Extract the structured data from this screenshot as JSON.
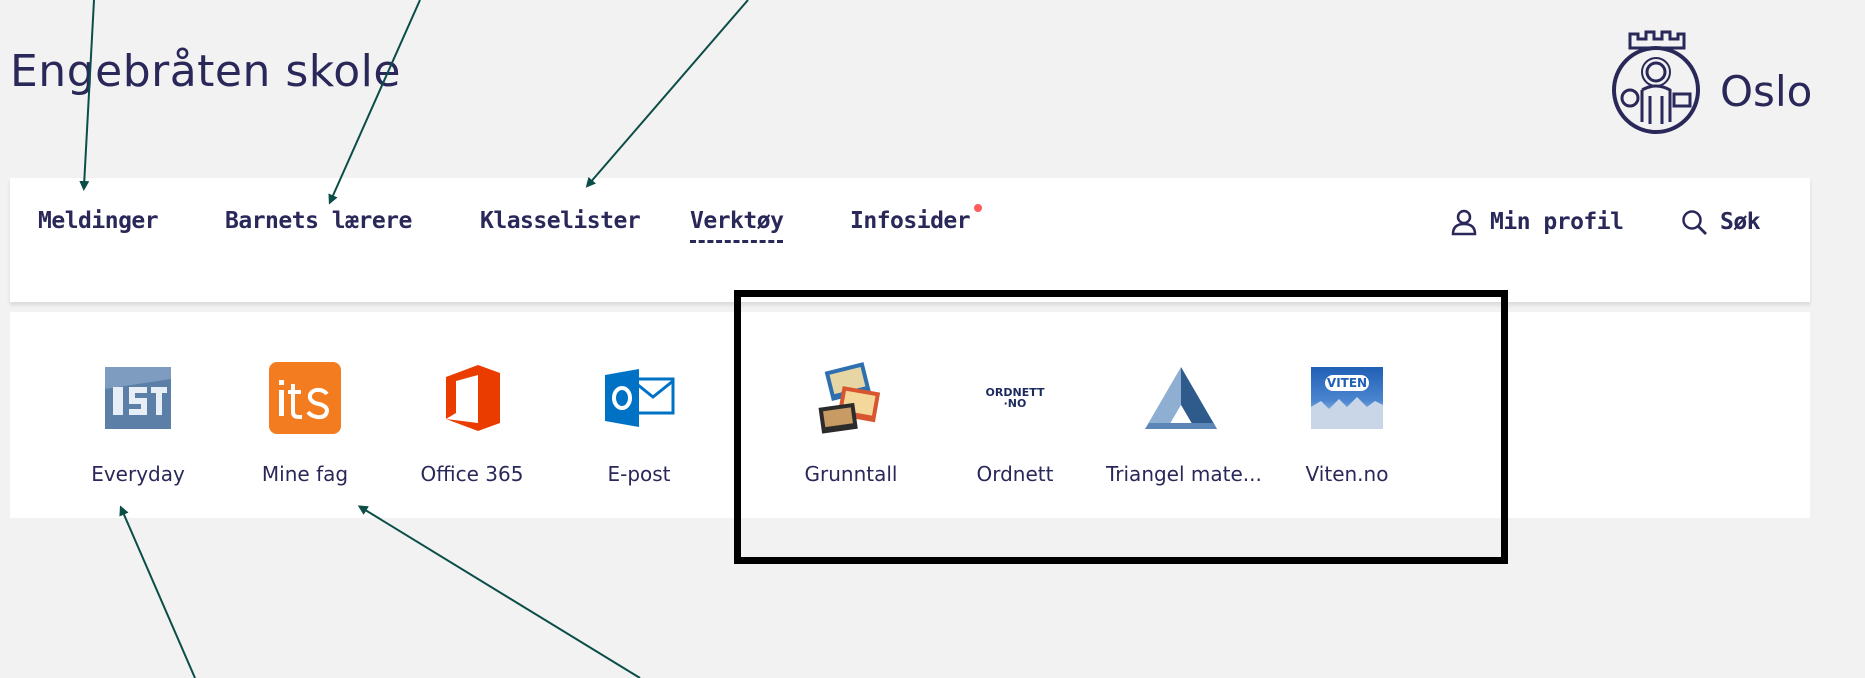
{
  "header": {
    "school_name": "Engebråten skole",
    "logo_text": "Oslo",
    "logo_icon": "oslo-seal-icon"
  },
  "nav": {
    "items": [
      {
        "label": "Meldinger",
        "active": false
      },
      {
        "label": "Barnets lærere",
        "active": false
      },
      {
        "label": "Klasselister",
        "active": false
      },
      {
        "label": "Verktøy",
        "active": true
      },
      {
        "label": "Infosider",
        "active": false,
        "notification": true
      }
    ],
    "profile_label": "Min profil",
    "search_label": "Søk"
  },
  "tools": [
    {
      "label": "Everyday",
      "icon": "ist-icon"
    },
    {
      "label": "Mine fag",
      "icon": "its-icon"
    },
    {
      "label": "Office 365",
      "icon": "office-icon"
    },
    {
      "label": "E-post",
      "icon": "outlook-icon"
    },
    {
      "label": "Grunntall",
      "icon": "grunntall-books-icon"
    },
    {
      "label": "Ordnett",
      "icon": "ordnett-icon",
      "icon_text_1": "ORDNETT",
      "icon_text_2": "·NO"
    },
    {
      "label": "Triangel mate...",
      "icon": "triangle-icon"
    },
    {
      "label": "Viten.no",
      "icon": "viten-icon",
      "icon_text": "VITEN"
    }
  ],
  "colors": {
    "brand_text": "#2a2859",
    "notification_dot": "#ff5b5b",
    "annotation_arrow": "#0b4d47",
    "highlight_box": "#000000",
    "background": "#f2f2f2"
  }
}
